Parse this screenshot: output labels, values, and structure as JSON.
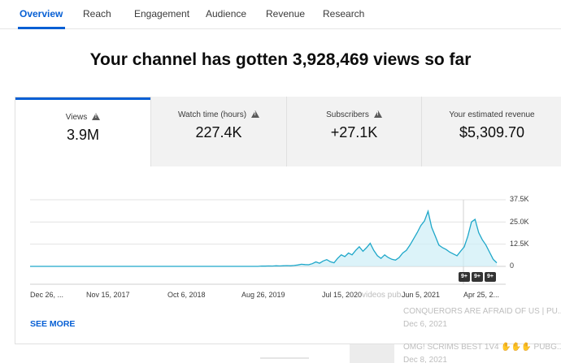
{
  "tabs": [
    {
      "label": "Overview"
    },
    {
      "label": "Reach"
    },
    {
      "label": "Engagement"
    },
    {
      "label": "Audience"
    },
    {
      "label": "Revenue"
    },
    {
      "label": "Research"
    }
  ],
  "headline": "Your channel has gotten 3,928,469 views so far",
  "metrics": [
    {
      "label": "Views",
      "value": "3.9M",
      "warning": true
    },
    {
      "label": "Watch time (hours)",
      "value": "227.4K",
      "warning": true
    },
    {
      "label": "Subscribers",
      "value": "+27.1K",
      "warning": true
    },
    {
      "label": "Your estimated revenue",
      "value": "$5,309.70",
      "warning": false
    }
  ],
  "chart_data": {
    "type": "area",
    "title": "",
    "xlabel": "",
    "ylabel": "",
    "x_tick_labels": [
      "Dec 26, ...",
      "Nov 15, 2017",
      "Oct 6, 2018",
      "Aug 26, 2019",
      "Jul 15, 2020",
      "Jun 5, 2021",
      "Apr 25, 2..."
    ],
    "y_tick_labels": [
      "37.5K",
      "25.0K",
      "12.5K",
      "0"
    ],
    "ylim": [
      0,
      37500
    ],
    "grid": true,
    "series": [
      {
        "values": [
          0,
          0,
          0,
          0,
          0,
          0,
          0,
          0,
          0,
          0,
          0,
          0,
          0,
          0,
          0,
          0,
          0,
          0,
          0,
          0,
          0,
          0,
          0,
          0,
          0,
          0,
          0,
          0,
          0,
          0,
          0,
          0,
          0,
          0,
          0,
          0,
          0,
          0,
          0,
          0,
          0,
          0,
          0,
          0,
          0,
          0,
          0,
          0,
          0,
          0,
          0,
          0,
          0,
          0,
          0,
          0,
          0,
          0,
          0,
          0,
          0,
          0,
          0,
          0,
          200,
          150,
          250,
          200,
          300,
          250,
          300,
          400,
          300,
          500,
          800,
          1200,
          1000,
          900,
          1500,
          2500,
          1800,
          3000,
          3800,
          2600,
          2000,
          4500,
          6500,
          5500,
          7500,
          6500,
          9000,
          11000,
          8500,
          10500,
          13000,
          9000,
          6000,
          4500,
          6500,
          5000,
          4000,
          3500,
          5000,
          7500,
          9000,
          12000,
          15500,
          19000,
          23000,
          25500,
          31000,
          22000,
          17000,
          12000,
          10500,
          9500,
          8000,
          7000,
          6000,
          8500,
          11000,
          17000,
          25000,
          26500,
          19000,
          15000,
          12000,
          8000,
          4000,
          2000
        ]
      }
    ]
  },
  "overlay_badges": [
    "9+",
    "9+",
    "9+"
  ],
  "see_more": "SEE MORE",
  "background_list": {
    "partial_label": "videos pub...",
    "items": [
      {
        "title": "CONQUERORS ARE AFRAID OF US | PU...",
        "date": "Dec 6, 2021"
      },
      {
        "title": "OMG! SCRIMS BEST 1V4 ✋✋✋ PUBG...",
        "date": "Dec 8, 2021"
      }
    ]
  },
  "colors": {
    "accent": "#065fd4",
    "line": "#1ea7c9",
    "fill": "#cdeef7"
  }
}
